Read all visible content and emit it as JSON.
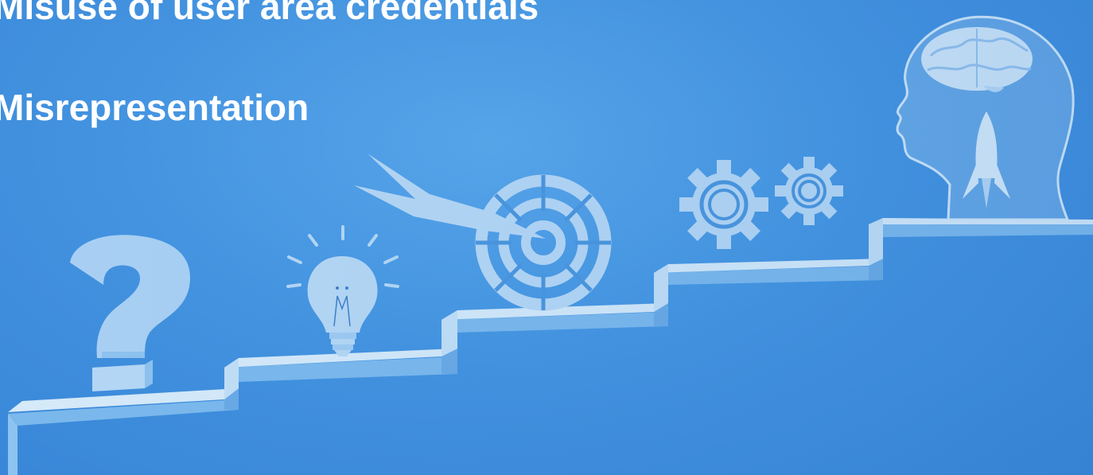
{
  "slide": {
    "lines": [
      "Misuse of user area credentials",
      "Misrepresentation"
    ]
  },
  "illustration": {
    "icons": [
      "question-mark-icon",
      "lightbulb-icon",
      "target-icon",
      "arrow-icon",
      "gears-icon",
      "head-profile-icon",
      "brain-icon",
      "rocket-icon"
    ],
    "colors": {
      "background": "#4393e0",
      "background_light": "#58a6ea",
      "stair_top": "#d3e8f8",
      "stair_riser": "#74b4ec",
      "icon_fill": "#b6d7f4",
      "text": "#ffffff"
    }
  }
}
